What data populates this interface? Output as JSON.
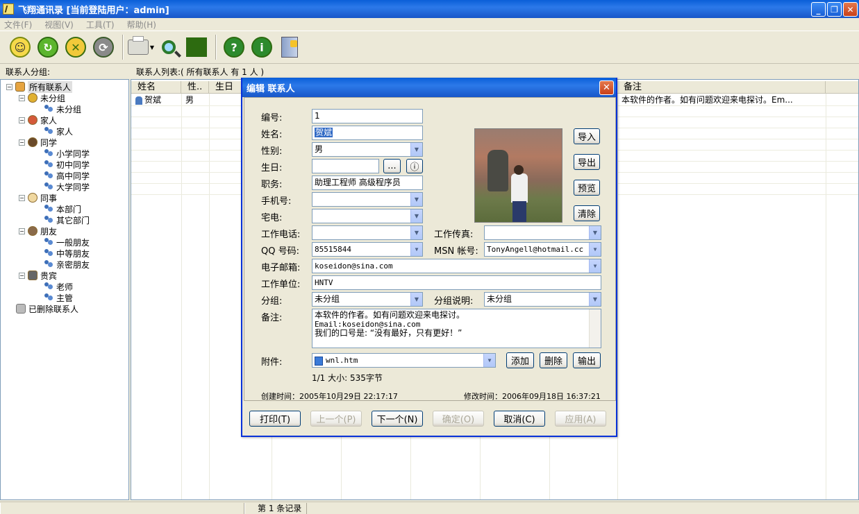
{
  "window": {
    "title": "飞翔通讯录  [当前登陆用户：admin]"
  },
  "menu": [
    "文件(F)",
    "视图(V)",
    "工具(T)",
    "帮助(H)"
  ],
  "toolbar": {
    "icons": [
      "add-contact-icon",
      "edit-contact-icon",
      "delete-contact-icon",
      "refresh-icon",
      "print-icon",
      "search-icon",
      "calendar-icon",
      "help-icon",
      "about-icon",
      "exit-icon"
    ]
  },
  "left_panel": {
    "label": "联系人分组:"
  },
  "list_header": {
    "label": "联系人列表:( 所有联系人 有 1 人 )"
  },
  "tree": {
    "root": "所有联系人",
    "groups": [
      {
        "name": "未分组",
        "children": [
          "未分组"
        ]
      },
      {
        "name": "家人",
        "children": [
          "家人"
        ]
      },
      {
        "name": "同学",
        "children": [
          "小学同学",
          "初中同学",
          "高中同学",
          "大学同学"
        ]
      },
      {
        "name": "同事",
        "children": [
          "本部门",
          "其它部门"
        ]
      },
      {
        "name": "朋友",
        "children": [
          "一般朋友",
          "中等朋友",
          "亲密朋友"
        ]
      },
      {
        "name": "贵宾",
        "children": [
          "老师",
          "主管"
        ]
      }
    ],
    "deleted": "已删除联系人"
  },
  "grid": {
    "columns": [
      "姓名",
      "性..",
      "生日",
      "备注"
    ],
    "rows": [
      {
        "name": "贺斌",
        "gender": "男",
        "note": "本软件的作者。如有问题欢迎来电探讨。Em..."
      }
    ]
  },
  "status": {
    "record": "第 1 条记录"
  },
  "dialog": {
    "title": "编辑 联系人",
    "labels": {
      "id": "编号:",
      "name": "姓名:",
      "gender": "性别:",
      "birthday": "生日:",
      "position": "职务:",
      "mobile": "手机号:",
      "home_phone": "宅电:",
      "work_phone": "工作电话:",
      "work_fax": "工作传真:",
      "qq": "QQ 号码:",
      "msn": "MSN 帐号:",
      "email": "电子邮箱:",
      "company": "工作单位:",
      "group": "分组:",
      "group_desc": "分组说明:",
      "notes": "备注:",
      "attachment": "附件:"
    },
    "values": {
      "id": "1",
      "name": "贺斌",
      "gender": "男",
      "birthday": "",
      "position": "助理工程师 高级程序员",
      "mobile": "",
      "home_phone": "",
      "work_phone": "",
      "work_fax": "",
      "qq": "85515844",
      "msn": "TonyAngell@hotmail.cc",
      "email": "koseidon@sina.com",
      "company": "HNTV",
      "group": "未分组",
      "group_desc": "未分组",
      "notes": [
        "本软件的作者。如有问题欢迎来电探讨。",
        "Email:koseidon@sina.com",
        "我们的口号是: “没有最好，只有更好！”"
      ],
      "attachment": "wnl.htm"
    },
    "birthday_buttons": {
      "pick": "...",
      "info": "ⓘ"
    },
    "photo_buttons": {
      "import": "导入",
      "export": "导出",
      "preview": "预览",
      "clear": "清除"
    },
    "attach_buttons": {
      "add": "添加",
      "delete": "删除",
      "output": "输出"
    },
    "attach_info": "1/1  大小: 535字节",
    "created": "创建时间：2005年10月29日 22:17:17",
    "modified": "修改时间：2006年09月18日 16:37:21",
    "footer_buttons": {
      "print": "打印(T)",
      "prev": "上一个(P)",
      "next": "下一个(N)",
      "ok": "确定(O)",
      "cancel": "取消(C)",
      "apply": "应用(A)"
    }
  }
}
